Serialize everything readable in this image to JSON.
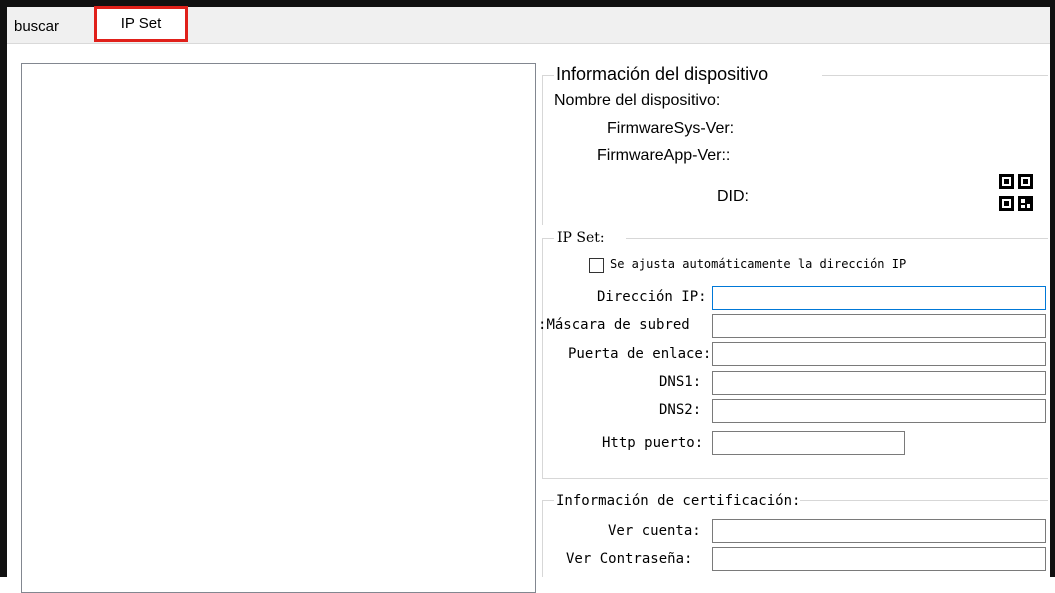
{
  "tabs": {
    "buscar": "buscar",
    "ipset": "IP Set"
  },
  "device_info": {
    "title": "Información del dispositivo",
    "name_label": "Nombre del dispositivo:",
    "firmware_sys_label": "FirmwareSys-Ver:",
    "firmware_app_label": "FirmwareApp-Ver::",
    "did_label": "DID:",
    "qr_icon": "qr-code-icon"
  },
  "ip_set": {
    "title": "IP Set:",
    "auto_ip_label": "Se ajusta automáticamente la dirección IP",
    "auto_ip_checked": false,
    "ip_label": "Dirección IP:",
    "ip_value": "",
    "mask_label": "Máscara de subred:",
    "mask_value": "",
    "gateway_label": "Puerta de enlace:",
    "gateway_value": "",
    "dns1_label": "DNS1:",
    "dns1_value": "",
    "dns2_label": "DNS2:",
    "dns2_value": "",
    "http_label": "Http puerto:",
    "http_value": ""
  },
  "cert": {
    "title": "Información de certificación:",
    "account_label": "Ver cuenta:",
    "account_value": "",
    "password_label": "Ver Contraseña:",
    "password_value": ""
  },
  "colors": {
    "highlight": "#e0201a",
    "focus": "#0078d7"
  }
}
